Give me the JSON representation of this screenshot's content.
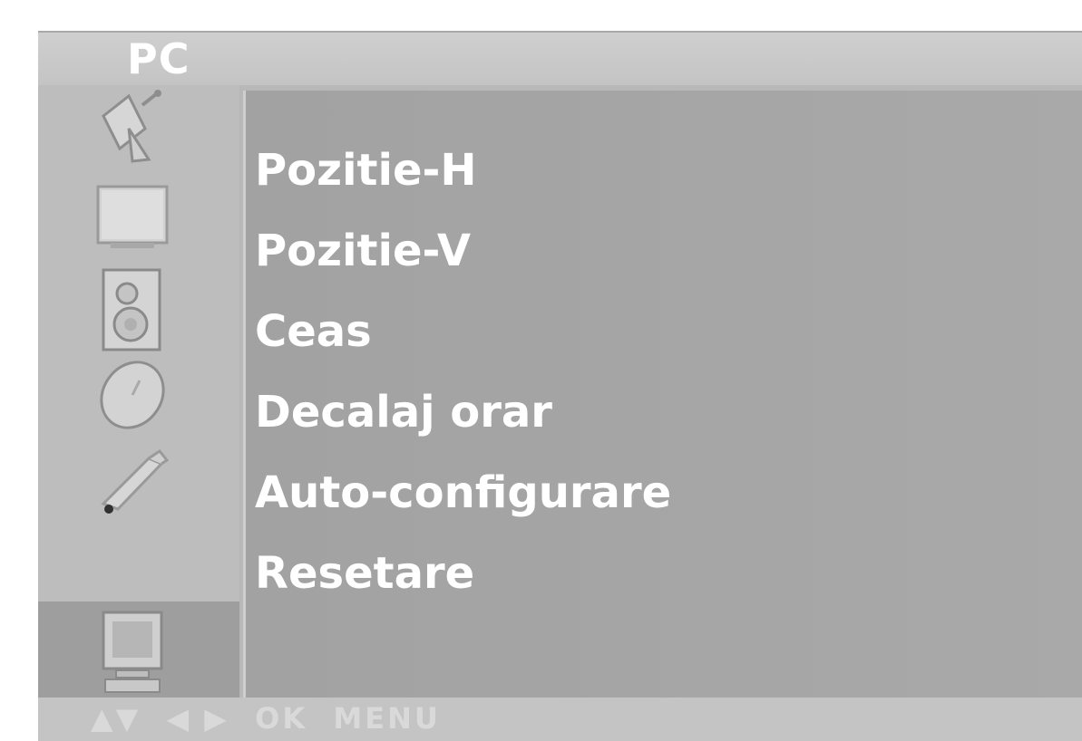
{
  "title": "PC",
  "sidebar": {
    "items": [
      {
        "icon": "satellite-dish-icon",
        "selected": false
      },
      {
        "icon": "picture-icon",
        "selected": false
      },
      {
        "icon": "speaker-icon",
        "selected": false
      },
      {
        "icon": "clock-icon",
        "selected": false
      },
      {
        "icon": "special-wrench-icon",
        "selected": false
      },
      {
        "icon": "pc-monitor-icon",
        "selected": true
      }
    ]
  },
  "menu": {
    "items": [
      {
        "label": "Pozitie-H"
      },
      {
        "label": "Pozitie-V"
      },
      {
        "label": "Ceas"
      },
      {
        "label": "Decalaj orar"
      },
      {
        "label": "Auto-configurare"
      },
      {
        "label": "Resetare"
      }
    ]
  },
  "footer": {
    "hint": "▲▼  ◀ ▶  OK  MENU"
  }
}
